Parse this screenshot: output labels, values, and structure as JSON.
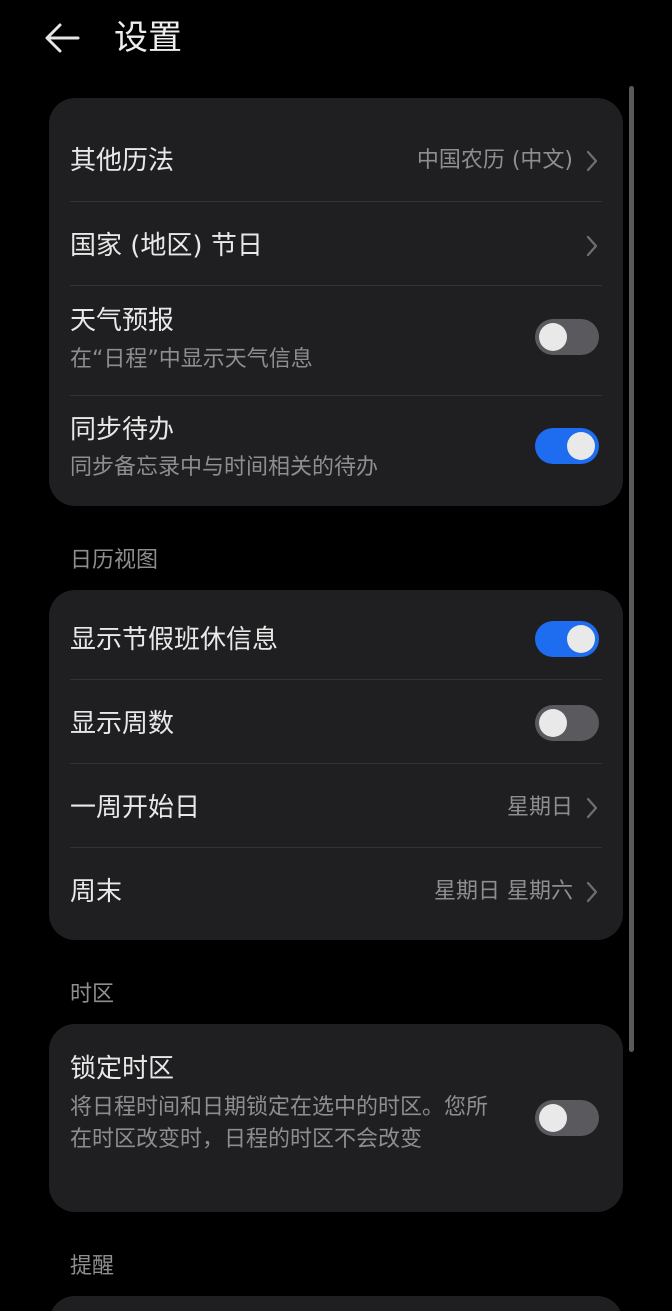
{
  "header": {
    "title": "设置"
  },
  "card1": {
    "other_calendar": {
      "label": "其他历法",
      "value": "中国农历 (中文)"
    },
    "holidays": {
      "label": "国家 (地区) 节日"
    },
    "weather": {
      "label": "天气预报",
      "sub": "在“日程”中显示天气信息",
      "enabled": false
    },
    "sync_todo": {
      "label": "同步待办",
      "sub": "同步备忘录中与时间相关的待办",
      "enabled": true
    }
  },
  "calendar_view": {
    "section_label": "日历视图",
    "show_holiday": {
      "label": "显示节假班休信息",
      "enabled": true
    },
    "show_week_number": {
      "label": "显示周数",
      "enabled": false
    },
    "week_start": {
      "label": "一周开始日",
      "value": "星期日"
    },
    "weekend": {
      "label": "周末",
      "value": "星期日 星期六"
    }
  },
  "timezone": {
    "section_label": "时区",
    "lock_timezone": {
      "label": "锁定时区",
      "sub": "将日程时间和日期锁定在选中的时区。您所在时区改变时，日程的时区不会改变",
      "enabled": false
    }
  },
  "reminder": {
    "section_label": "提醒"
  },
  "colors": {
    "background": "#000000",
    "card": "#1f1f21",
    "accent": "#1e6cf0",
    "toggle_off": "#5a5a5e"
  }
}
